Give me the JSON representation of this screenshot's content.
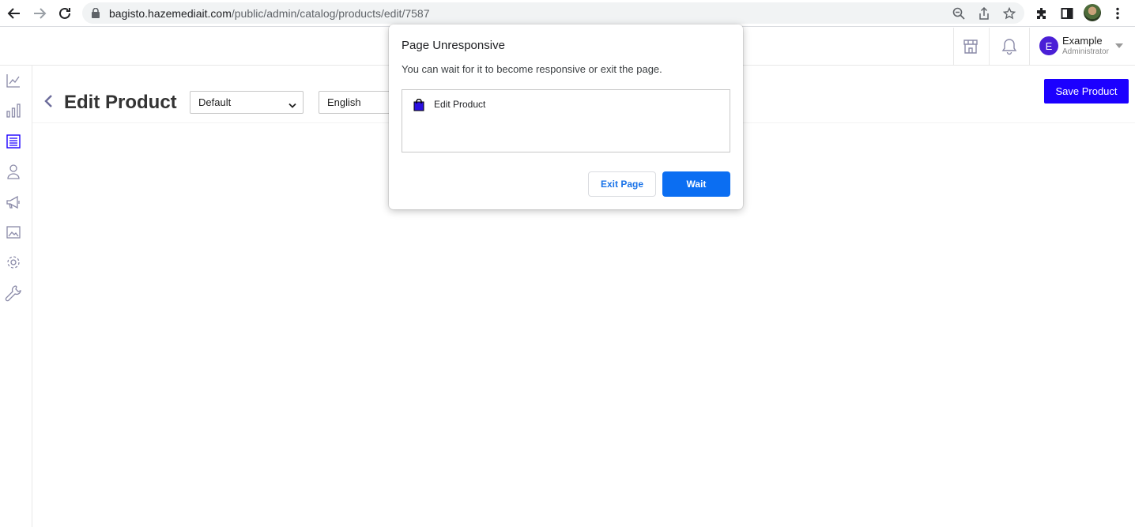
{
  "browser": {
    "url_host": "bagisto.hazemediait.com",
    "url_path": "/public/admin/catalog/products/edit/7587"
  },
  "header": {
    "user_initial": "E",
    "user_name": "Example",
    "user_role": "Administrator"
  },
  "page": {
    "title": "Edit Product",
    "channel_select": "Default",
    "locale_select": "English",
    "save_label": "Save Product"
  },
  "dialog": {
    "title": "Page Unresponsive",
    "message": "You can wait for it to become responsive or exit the page.",
    "item_label": "Edit Product",
    "exit_label": "Exit Page",
    "wait_label": "Wait"
  },
  "colors": {
    "accent": "#1c00ff",
    "avatar": "#4a1fd6",
    "chrome_blue": "#0b6ef2"
  }
}
